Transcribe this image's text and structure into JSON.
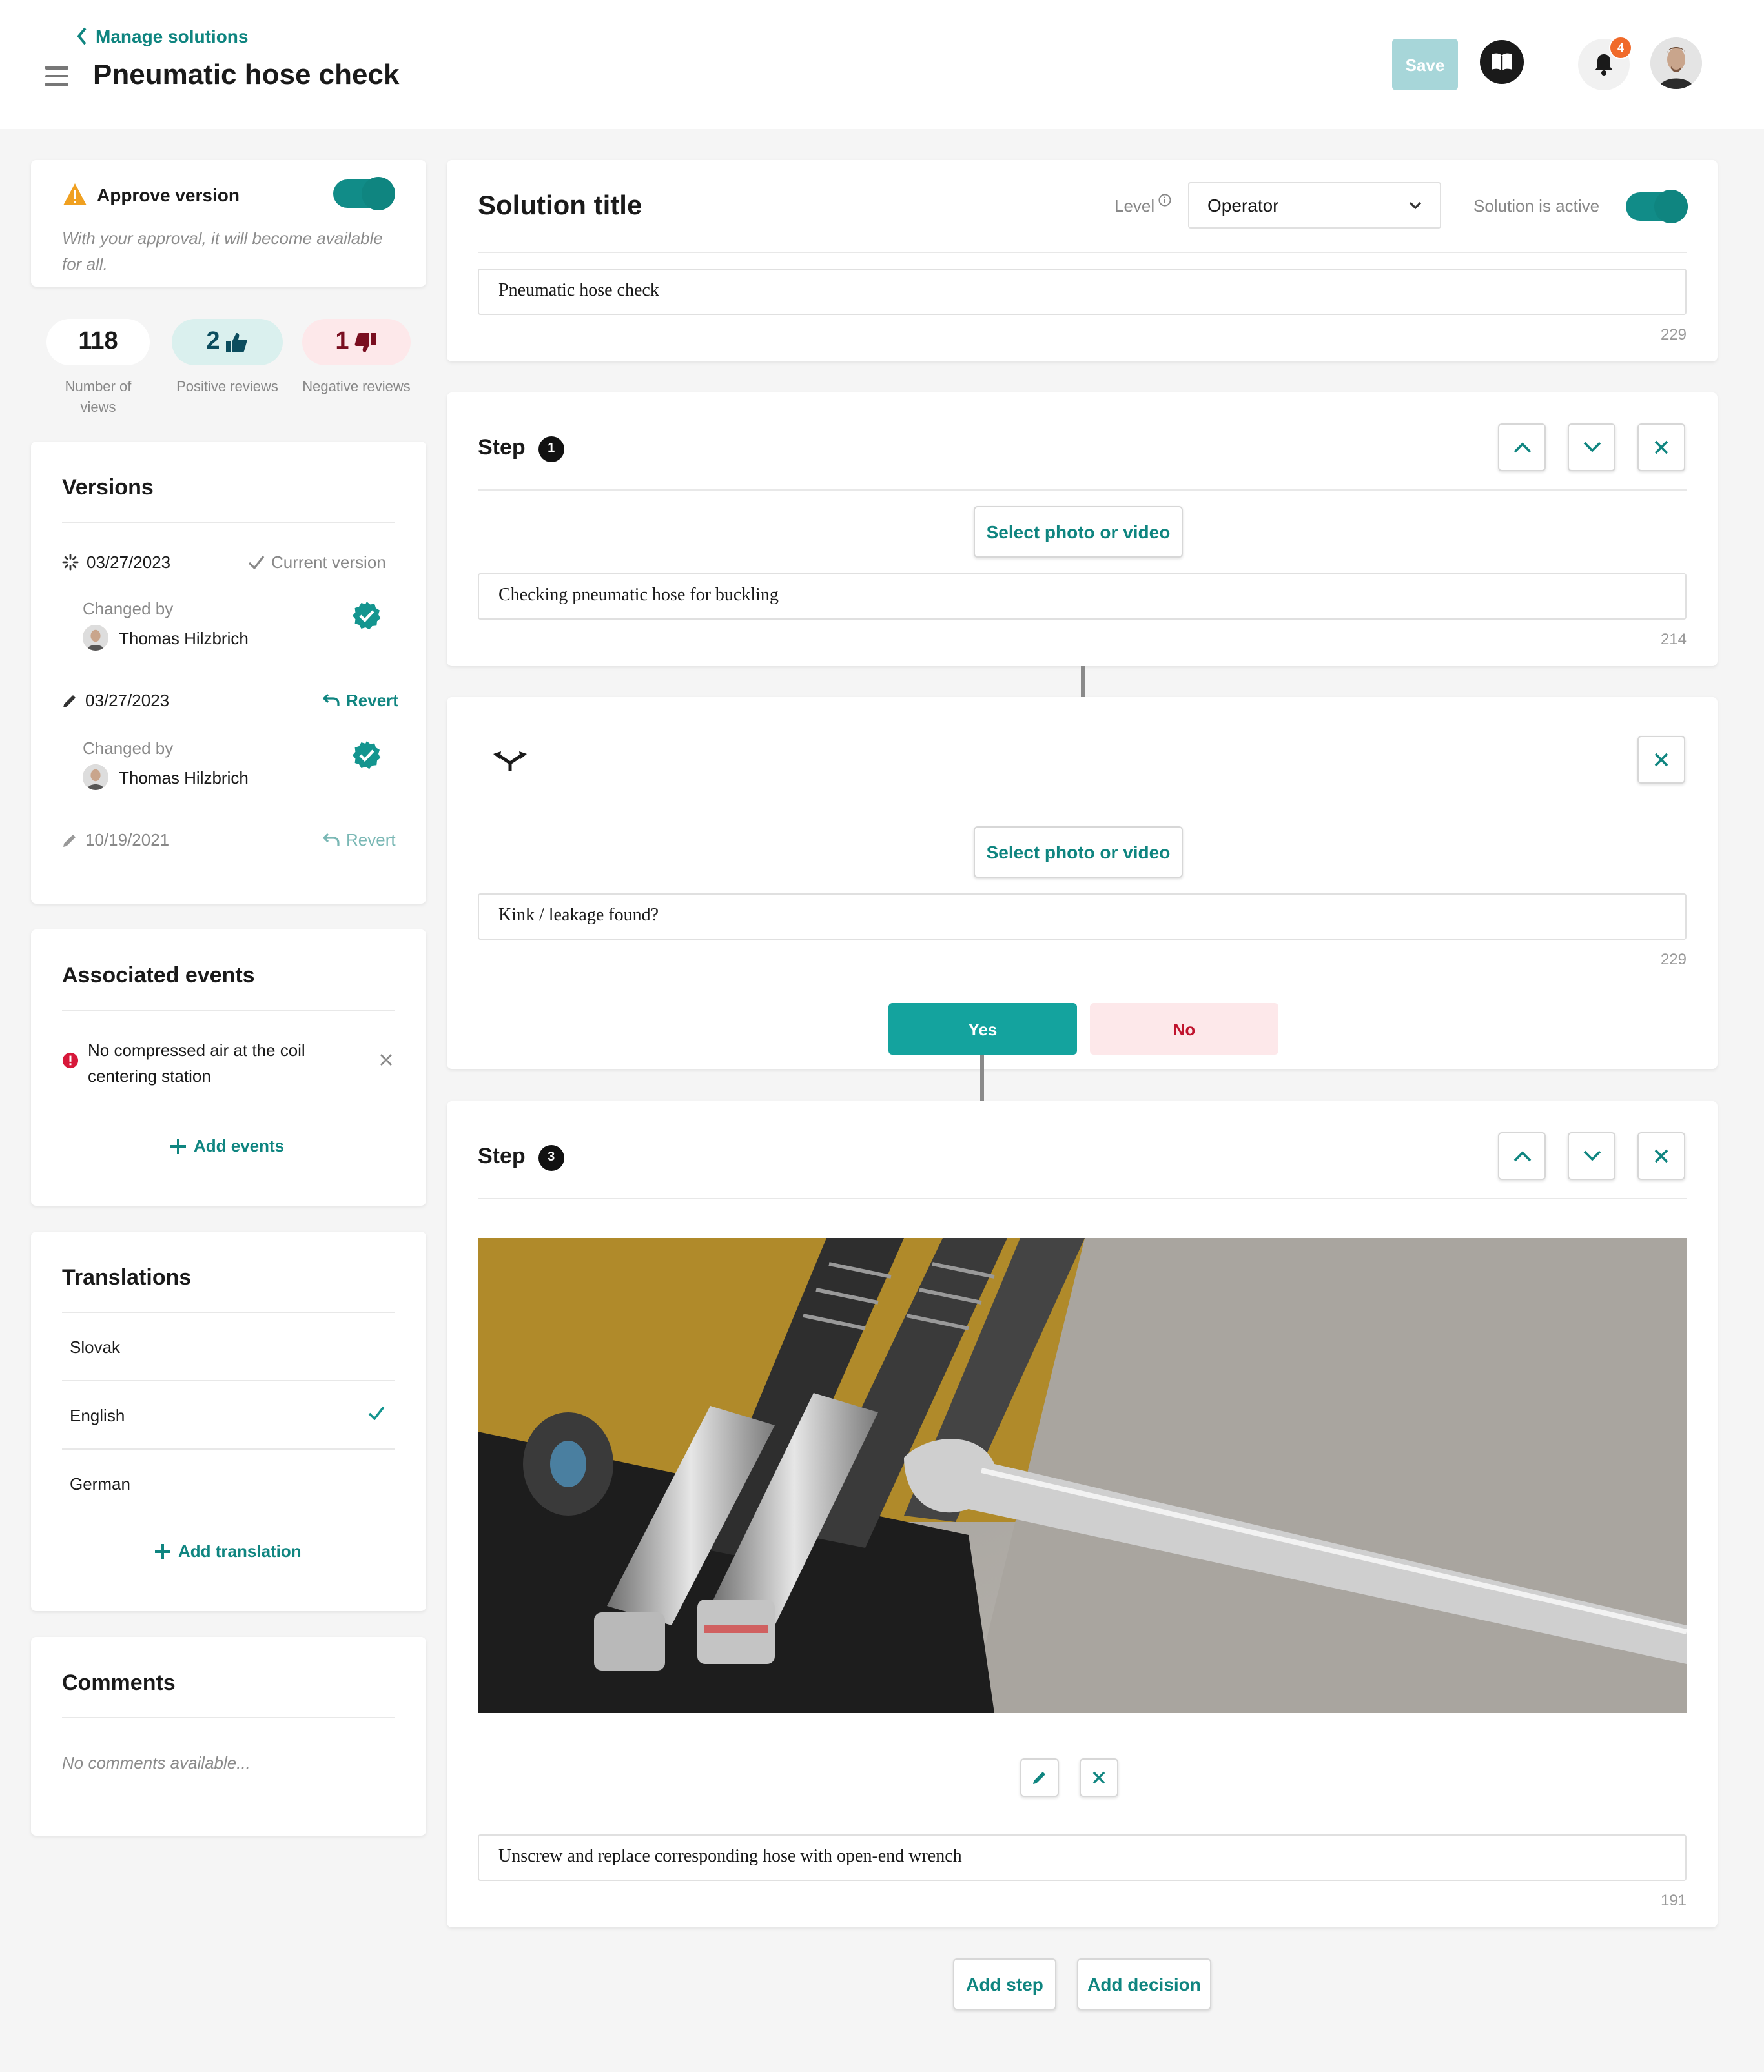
{
  "header": {
    "back_label": "Manage solutions",
    "title": "Pneumatic hose check",
    "save_label": "Save",
    "notification_count": "4"
  },
  "approve": {
    "title": "Approve version",
    "description": "With your approval, it will become available for all."
  },
  "stats": {
    "views": {
      "value": "118",
      "label": "Number of views"
    },
    "positive": {
      "value": "2",
      "label": "Positive reviews"
    },
    "negative": {
      "value": "1",
      "label": "Negative reviews"
    }
  },
  "versions": {
    "title": "Versions",
    "items": [
      {
        "date": "03/27/2023",
        "status": "Current version",
        "changed_by_label": "Changed by",
        "user": "Thomas Hilzbrich"
      },
      {
        "date": "03/27/2023",
        "status": "Revert",
        "changed_by_label": "Changed by",
        "user": "Thomas Hilzbrich"
      },
      {
        "date": "10/19/2021",
        "status": "Revert"
      }
    ]
  },
  "events": {
    "title": "Associated events",
    "items": [
      {
        "label": "No compressed air at the coil centering station"
      }
    ],
    "add_label": "Add events"
  },
  "translations": {
    "title": "Translations",
    "items": [
      {
        "label": "Slovak"
      },
      {
        "label": "English"
      },
      {
        "label": "German"
      }
    ],
    "add_label": "Add translation"
  },
  "comments": {
    "title": "Comments",
    "empty": "No comments available..."
  },
  "solution": {
    "title": "Solution title",
    "level_label": "Level",
    "level_value": "Operator",
    "active_label": "Solution is active",
    "value": "Pneumatic hose check",
    "counter": "229"
  },
  "steps": [
    {
      "label": "Step",
      "number": "1",
      "media_button": "Select photo or video",
      "text": "Checking pneumatic hose for buckling",
      "counter": "214"
    },
    {
      "media_button": "Select photo or video",
      "text": "Kink / leakage found?",
      "counter": "229",
      "yes_label": "Yes",
      "no_label": "No"
    },
    {
      "label": "Step",
      "number": "3",
      "text": "Unscrew and replace corresponding hose with open-end wrench",
      "counter": "191"
    }
  ],
  "footer": {
    "add_step": "Add step",
    "add_decision": "Add decision"
  },
  "colors": {
    "accent": "#0f8580",
    "positive_bg": "#daf0ee",
    "negative_bg": "#fde8ea",
    "negative_text": "#c0142e",
    "save_disabled": "#a7d6d9"
  }
}
